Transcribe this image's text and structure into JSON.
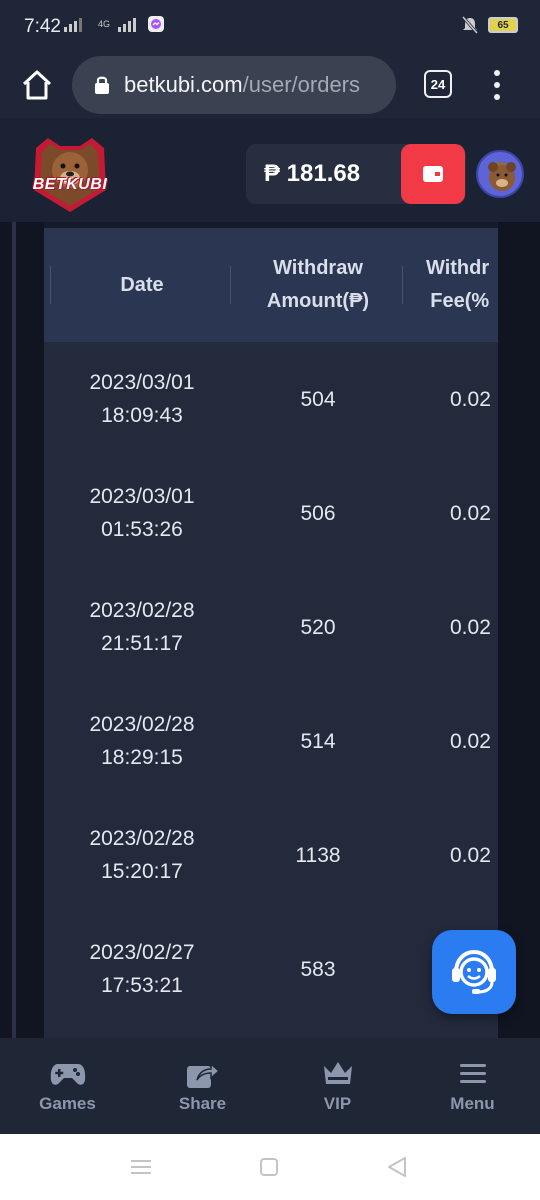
{
  "status_bar": {
    "time": "7:42",
    "network": "4G",
    "battery": "65"
  },
  "browser": {
    "url_host": "betkubi.com",
    "url_path": "/user/orders",
    "tab_count": "24"
  },
  "header": {
    "logo_text": "BETKUBI",
    "balance": "₱ 181.68"
  },
  "table": {
    "columns": [
      "Date",
      "Withdraw Amount(₱)",
      "Withdraw Fee(%)"
    ],
    "column_display": [
      "Date",
      "Withdraw\nAmount(₱)",
      "Withdr\nFee(%"
    ],
    "rows": [
      {
        "date": "2023/03/01\n18:09:43",
        "amount": "504",
        "fee": "0.02"
      },
      {
        "date": "2023/03/01\n01:53:26",
        "amount": "506",
        "fee": "0.02"
      },
      {
        "date": "2023/02/28\n21:51:17",
        "amount": "520",
        "fee": "0.02"
      },
      {
        "date": "2023/02/28\n18:29:15",
        "amount": "514",
        "fee": "0.02"
      },
      {
        "date": "2023/02/28\n15:20:17",
        "amount": "1138",
        "fee": "0.02"
      },
      {
        "date": "2023/02/27\n17:53:21",
        "amount": "583",
        "fee": ""
      }
    ]
  },
  "bottom_nav": [
    {
      "label": "Games",
      "icon": "gamepad-icon"
    },
    {
      "label": "Share",
      "icon": "share-icon"
    },
    {
      "label": "VIP",
      "icon": "crown-icon"
    },
    {
      "label": "Menu",
      "icon": "menu-icon"
    }
  ],
  "colors": {
    "accent_red": "#f23a47",
    "support_blue": "#2a7cf0",
    "page_bg": "#1b2233"
  }
}
